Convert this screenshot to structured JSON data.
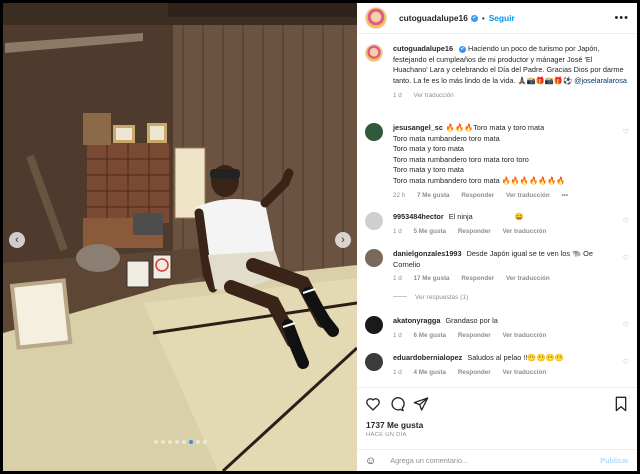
{
  "post": {
    "username": "cutoguadalupe16",
    "follow_label": "Seguir",
    "separator": "•",
    "more_label": "•••",
    "caption": "Haciendo un poco de turismo por Japón, festejando el cumpleaños de mi productor y mánager José 'El Huachano' Lara y celebrando el Día del Padre. Gracias Dios por darme tanto. La fe es lo más lindo de la vida. 🙏🏾📸🎁📸🎁⚽",
    "caption_mention": "@joselaralarosa",
    "caption_time": "1 d",
    "caption_translate": "Ver traducción"
  },
  "comments": [
    {
      "user": "jesusangel_sc",
      "text": "🔥🔥🔥Toro mata y toro mata\nToro mata rumbandero toro mata\nToro mata y toro mata\nToro mata rumbandero toro mata toro toro\nToro mata y toro mata\nToro mata rumbandero toro mata 🔥🔥🔥🔥🔥🔥🔥",
      "time": "22 h",
      "likes": "7 Me gusta",
      "reply": "Responder",
      "translate": "Ver traducción",
      "more": "•••"
    },
    {
      "user": "9953484hector",
      "text": "El ninja",
      "emoji": "😄",
      "time": "1 d",
      "likes": "5 Me gusta",
      "reply": "Responder",
      "translate": "Ver traducción"
    },
    {
      "user": "danielgonzales1993",
      "text": "Desde Japón igual se te ven los 🐃 Oe Cornelio",
      "time": "1 d",
      "likes": "17 Me gusta",
      "reply": "Responder",
      "translate": "Ver traducción",
      "view_replies": "Ver respuestas (1)"
    },
    {
      "user": "akatonyragga",
      "text": "Grandaso por la",
      "time": "1 d",
      "likes": "6 Me gusta",
      "reply": "Responder",
      "translate": "Ver traducción"
    },
    {
      "user": "eduardobernialopez",
      "text": "Saludos al pelao !!😶😶😶😶",
      "time": "1 d",
      "likes": "4 Me gusta",
      "reply": "Responder",
      "translate": "Ver traducción"
    }
  ],
  "footer": {
    "likes_count": "1737 Me gusta",
    "time_ago": "HACE UN DÍA",
    "emoji_icon": "☺",
    "comment_placeholder": "Agrega un comentario...",
    "publish_label": "Publicar"
  },
  "photo": {
    "prev_arrow": "‹",
    "next_arrow": "›",
    "slide_count": 8,
    "active_slide": 5
  },
  "colors": {
    "accent": "#0095f6",
    "verified": "#3897f0",
    "muted": "#8e8e8e",
    "wood": "#5a4536",
    "tatami": "#d9cfa8"
  }
}
